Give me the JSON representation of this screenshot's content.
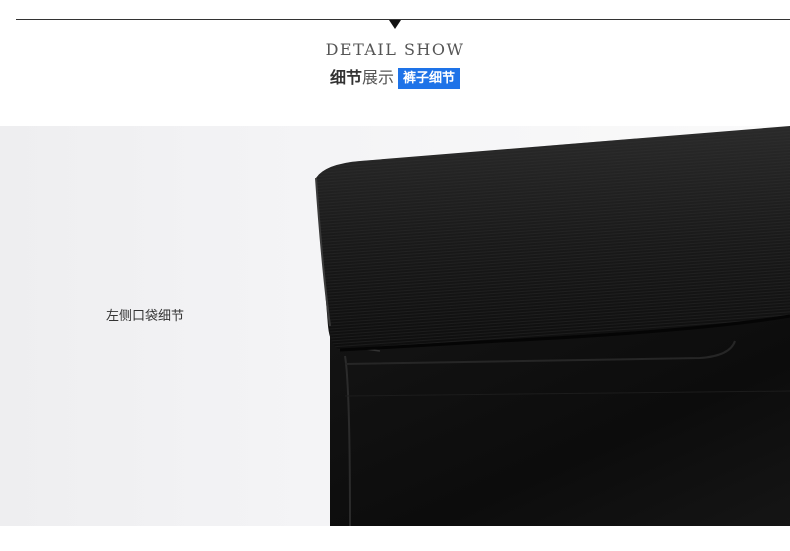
{
  "header": {
    "title_en": "DETAIL SHOW",
    "title_cn_bold": "细节",
    "title_cn_light": "展示",
    "tag": "裤子细节",
    "tag_color": "#1e73e8"
  },
  "photo": {
    "subject": "black-trousers-waistband-pocket-closeup",
    "caption": "左侧口袋细节"
  }
}
